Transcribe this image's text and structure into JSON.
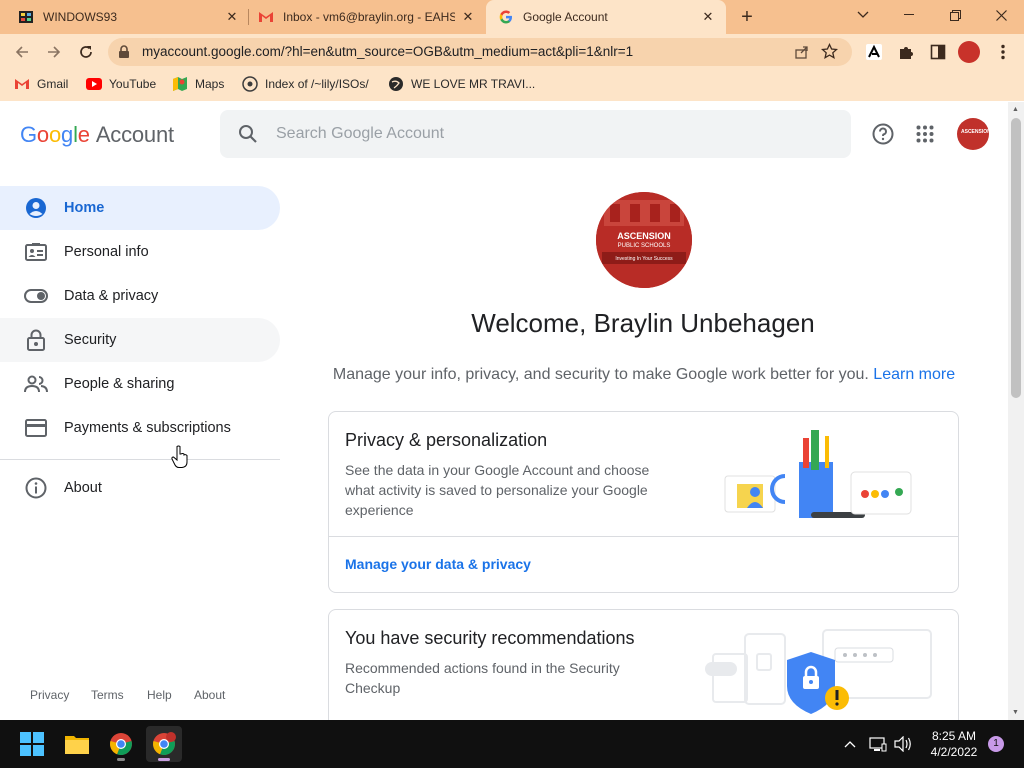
{
  "browser": {
    "tabs": [
      {
        "title": "WINDOWS93",
        "icon": "windows93-favicon",
        "active": false
      },
      {
        "title": "Inbox - vm6@braylin.org - EAHS",
        "icon": "gmail-favicon",
        "active": false
      },
      {
        "title": "Google Account",
        "icon": "google-favicon",
        "active": true
      }
    ],
    "url": "myaccount.google.com/?hl=en&utm_source=OGB&utm_medium=act&pli=1&nlr=1",
    "bookmarks": [
      {
        "label": "Gmail",
        "icon": "gmail-icon"
      },
      {
        "label": "YouTube",
        "icon": "youtube-icon"
      },
      {
        "label": "Maps",
        "icon": "maps-icon"
      },
      {
        "label": "Index of /~lily/ISOs/",
        "icon": "index-icon"
      },
      {
        "label": "WE LOVE MR TRAVI...",
        "icon": "globe-icon"
      }
    ],
    "theme": {
      "frame": "#f6c08f",
      "toolbar": "#fde4c8"
    }
  },
  "header": {
    "logo_google": [
      "G",
      "o",
      "o",
      "g",
      "l",
      "e"
    ],
    "logo_account": "Account",
    "search_placeholder": "Search Google Account"
  },
  "sidebar": {
    "items": [
      {
        "label": "Home",
        "icon": "account-circle-icon"
      },
      {
        "label": "Personal info",
        "icon": "id-card-icon"
      },
      {
        "label": "Data & privacy",
        "icon": "toggle-icon"
      },
      {
        "label": "Security",
        "icon": "lock-icon"
      },
      {
        "label": "People & sharing",
        "icon": "people-icon"
      },
      {
        "label": "Payments & subscriptions",
        "icon": "credit-card-icon"
      },
      {
        "label": "About",
        "icon": "info-icon"
      }
    ],
    "footer": [
      "Privacy",
      "Terms",
      "Help",
      "About"
    ]
  },
  "main": {
    "profile_text": [
      "ASCENSION",
      "PUBLIC SCHOOLS",
      "Investing In Your Success"
    ],
    "welcome": "Welcome, Braylin Unbehagen",
    "subtitle": "Manage your info, privacy, and security to make Google work better for you.",
    "learn_more": "Learn more",
    "cards": [
      {
        "title": "Privacy & personalization",
        "description": "See the data in your Google Account and choose what activity is saved to personalize your Google experience",
        "link": "Manage your data & privacy"
      },
      {
        "title": "You have security recommendations",
        "description": "Recommended actions found in the Security Checkup"
      }
    ]
  },
  "taskbar": {
    "time": "8:25 AM",
    "date": "4/2/2022",
    "notification_count": "1"
  },
  "colors": {
    "accent": "#1a73e8",
    "active_nav_bg": "#e8f0fe",
    "brand_red": "#c0312b"
  }
}
